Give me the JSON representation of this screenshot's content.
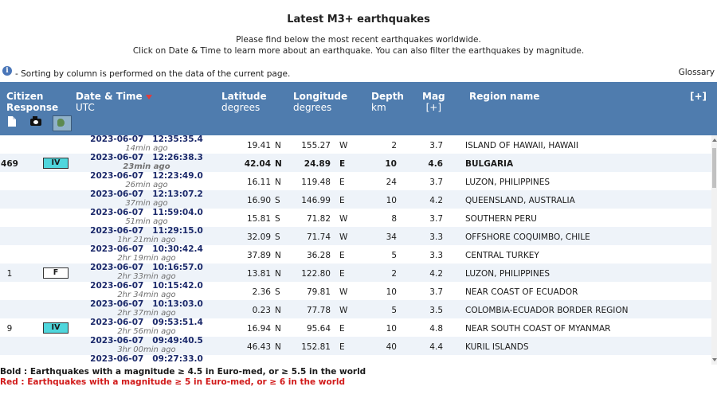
{
  "page": {
    "title": "Latest M3+ earthquakes",
    "intro_line1": "Please find below the most recent earthquakes worldwide.",
    "intro_line2": "Click on Date & Time to learn more about an earthquake. You can also filter the earthquakes by magnitude.",
    "info_glyph": "i",
    "sorting_note": " - Sorting by column is performed on the data of the current page.",
    "glossary_link": "Glossary"
  },
  "header": {
    "citizen_response_line1": "Citizen",
    "citizen_response_line2": "Response",
    "datetime_line1": "Date & Time",
    "datetime_line2": "UTC",
    "latitude_line1": "Latitude",
    "latitude_line2": "degrees",
    "longitude_line1": "Longitude",
    "longitude_line2": "degrees",
    "depth_line1": "Depth",
    "depth_line2": "km",
    "mag_line1": "Mag",
    "mag_line2": "[+]",
    "region": "Region name",
    "expand": "[+]",
    "header_bg": "#4f7cae"
  },
  "rows": [
    {
      "count": "",
      "badge": "",
      "date": "2023-06-07",
      "time": "12:35:35.4",
      "ago": "14min ago",
      "lat": "19.41",
      "lat_dir": "N",
      "lon": "155.27",
      "lon_dir": "W",
      "depth": "2",
      "mag": "3.7",
      "region": "ISLAND OF HAWAII, HAWAII"
    },
    {
      "count": "469",
      "badge": "IV",
      "date": "2023-06-07",
      "time": "12:26:38.3",
      "ago": "23min ago",
      "lat": "42.04",
      "lat_dir": "N",
      "lon": "24.89",
      "lon_dir": "E",
      "depth": "10",
      "mag": "4.6",
      "region": "BULGARIA"
    },
    {
      "count": "",
      "badge": "",
      "date": "2023-06-07",
      "time": "12:23:49.0",
      "ago": "26min ago",
      "lat": "16.11",
      "lat_dir": "N",
      "lon": "119.48",
      "lon_dir": "E",
      "depth": "24",
      "mag": "3.7",
      "region": "LUZON, PHILIPPINES"
    },
    {
      "count": "",
      "badge": "",
      "date": "2023-06-07",
      "time": "12:13:07.2",
      "ago": "37min ago",
      "lat": "16.90",
      "lat_dir": "S",
      "lon": "146.99",
      "lon_dir": "E",
      "depth": "10",
      "mag": "4.2",
      "region": "QUEENSLAND, AUSTRALIA"
    },
    {
      "count": "",
      "badge": "",
      "date": "2023-06-07",
      "time": "11:59:04.0",
      "ago": "51min ago",
      "lat": "15.81",
      "lat_dir": "S",
      "lon": "71.82",
      "lon_dir": "W",
      "depth": "8",
      "mag": "3.7",
      "region": "SOUTHERN PERU"
    },
    {
      "count": "",
      "badge": "",
      "date": "2023-06-07",
      "time": "11:29:15.0",
      "ago": "1hr 21min ago",
      "lat": "32.09",
      "lat_dir": "S",
      "lon": "71.74",
      "lon_dir": "W",
      "depth": "34",
      "mag": "3.3",
      "region": "OFFSHORE COQUIMBO, CHILE"
    },
    {
      "count": "",
      "badge": "",
      "date": "2023-06-07",
      "time": "10:30:42.4",
      "ago": "2hr 19min ago",
      "lat": "37.89",
      "lat_dir": "N",
      "lon": "36.28",
      "lon_dir": "E",
      "depth": "5",
      "mag": "3.3",
      "region": "CENTRAL TURKEY"
    },
    {
      "count": "1",
      "badge": "F",
      "date": "2023-06-07",
      "time": "10:16:57.0",
      "ago": "2hr 33min ago",
      "lat": "13.81",
      "lat_dir": "N",
      "lon": "122.80",
      "lon_dir": "E",
      "depth": "2",
      "mag": "4.2",
      "region": "LUZON, PHILIPPINES"
    },
    {
      "count": "",
      "badge": "",
      "date": "2023-06-07",
      "time": "10:15:42.0",
      "ago": "2hr 34min ago",
      "lat": "2.36",
      "lat_dir": "S",
      "lon": "79.81",
      "lon_dir": "W",
      "depth": "10",
      "mag": "3.7",
      "region": "NEAR COAST OF ECUADOR"
    },
    {
      "count": "",
      "badge": "",
      "date": "2023-06-07",
      "time": "10:13:03.0",
      "ago": "2hr 37min ago",
      "lat": "0.23",
      "lat_dir": "N",
      "lon": "77.78",
      "lon_dir": "W",
      "depth": "5",
      "mag": "3.5",
      "region": "COLOMBIA-ECUADOR BORDER REGION"
    },
    {
      "count": "9",
      "badge": "IV",
      "date": "2023-06-07",
      "time": "09:53:51.4",
      "ago": "2hr 56min ago",
      "lat": "16.94",
      "lat_dir": "N",
      "lon": "95.64",
      "lon_dir": "E",
      "depth": "10",
      "mag": "4.8",
      "region": "NEAR SOUTH COAST OF MYANMAR"
    },
    {
      "count": "",
      "badge": "",
      "date": "2023-06-07",
      "time": "09:49:40.5",
      "ago": "3hr 00min ago",
      "lat": "46.43",
      "lat_dir": "N",
      "lon": "152.81",
      "lon_dir": "E",
      "depth": "40",
      "mag": "4.4",
      "region": "KURIL ISLANDS"
    },
    {
      "count": "",
      "badge": "",
      "date": "2023-06-07",
      "time": "09:27:33.0",
      "ago": "",
      "lat": "",
      "lat_dir": "",
      "lon": "",
      "lon_dir": "",
      "depth": "",
      "mag": "",
      "region": ""
    }
  ],
  "legend": {
    "bold_text": "Bold : Earthquakes with a magnitude ≥ 4.5 in Euro-med, or ≥ 5.5 in the world",
    "red_text": "Red : Earthquakes with a magnitude ≥ 5 in Euro-med, or ≥ 6 in the world",
    "red_color": "#d11a1a"
  },
  "icons": {
    "header_icons": [
      "document-icon",
      "camera-icon",
      "map-icon"
    ],
    "info": "info-icon",
    "sort": "sort-desc-icon"
  }
}
